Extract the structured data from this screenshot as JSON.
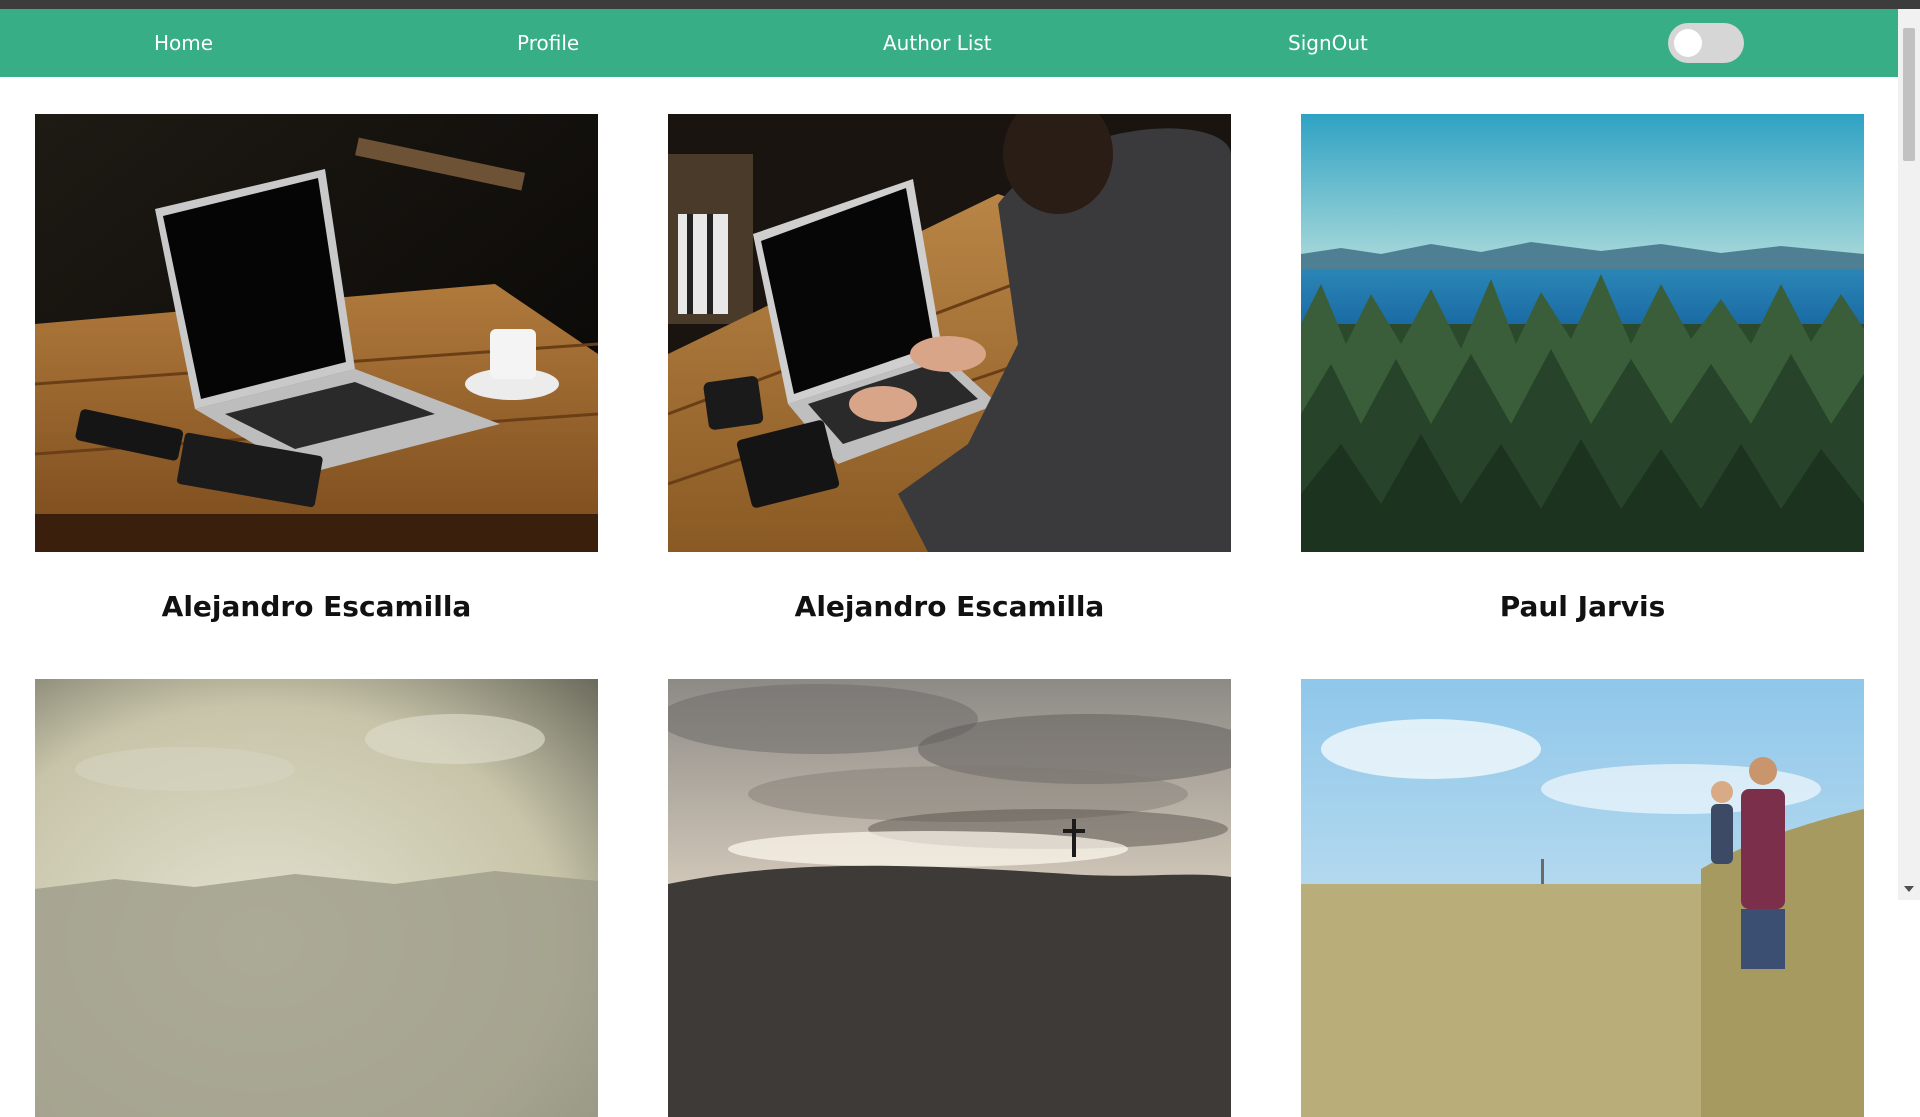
{
  "nav": {
    "links": [
      "Home",
      "Profile",
      "Author List",
      "SignOut"
    ],
    "dark_mode_toggle": "off"
  },
  "colors": {
    "navbar": "#37ae86",
    "nav_text": "#ffffff",
    "card_title": "#111111"
  },
  "cards": [
    {
      "author": "Alejandro Escamilla",
      "photo": "laptop on wooden table with phone, notebook and coffee cup"
    },
    {
      "author": "Alejandro Escamilla",
      "photo": "person typing on laptop at wooden table"
    },
    {
      "author": "Paul Jarvis",
      "photo": "forest of pine trees with sea and mountains"
    },
    {
      "author": "",
      "photo": "hazy sky over faint mountains"
    },
    {
      "author": "",
      "photo": "cloudy sky with cross on hill"
    },
    {
      "author": "",
      "photo": "man carrying child in field under sky"
    }
  ]
}
